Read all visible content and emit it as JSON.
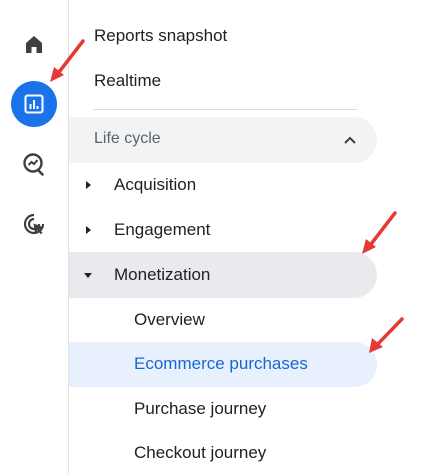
{
  "rail": {
    "items": [
      {
        "name": "home"
      },
      {
        "name": "reports",
        "active": true
      },
      {
        "name": "explore"
      },
      {
        "name": "advertising"
      }
    ]
  },
  "nav": {
    "reports_snapshot": "Reports snapshot",
    "realtime": "Realtime",
    "section": {
      "label": "Life cycle",
      "items": {
        "acquisition": "Acquisition",
        "engagement": "Engagement",
        "monetization": "Monetization"
      },
      "monetization_children": {
        "overview": "Overview",
        "ecommerce_purchases": "Ecommerce purchases",
        "purchase_journey": "Purchase journey",
        "checkout_journey": "Checkout journey"
      }
    }
  },
  "colors": {
    "accent": "#1a73e8",
    "selected_text": "#1967d2",
    "selected_bg": "#e8f0fe",
    "annotation_arrow": "#e53935"
  }
}
